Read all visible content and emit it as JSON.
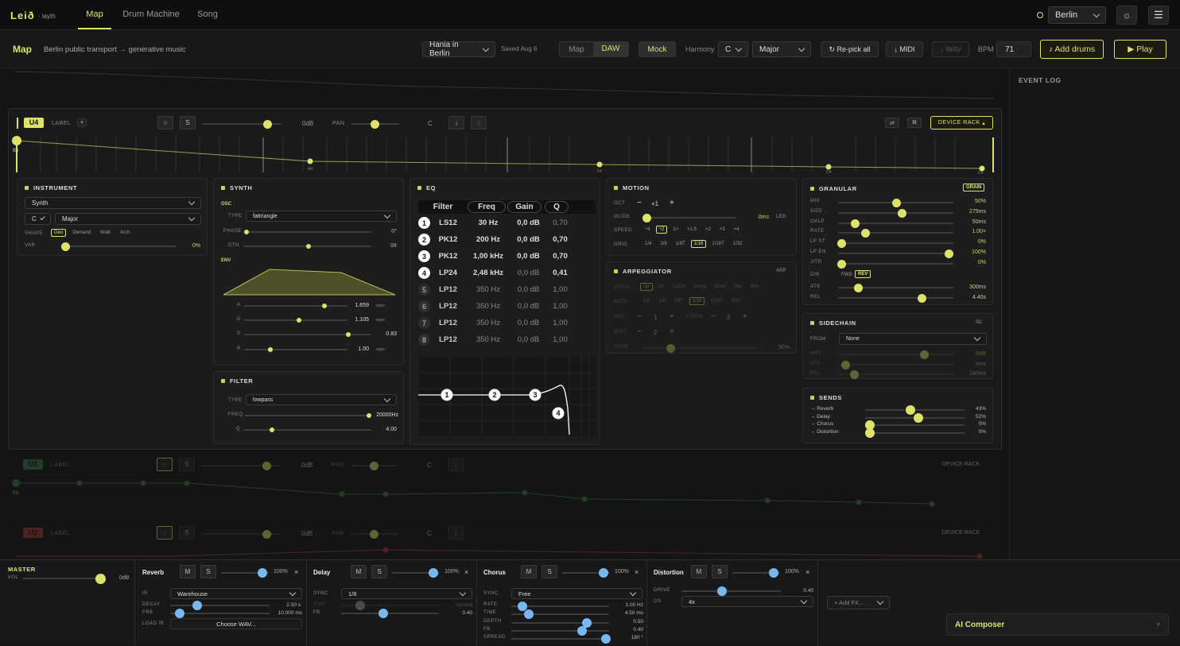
{
  "app": {
    "logo": "Leið",
    "logo_sub": "· layth",
    "tabs": [
      "Map",
      "Drum Machine",
      "Song"
    ],
    "city": "Berlin"
  },
  "subbar": {
    "title": "Map",
    "subtitle": "Berlin public transport → generative music",
    "project": "Hania in Berlin",
    "saved": "Saved Aug 6",
    "view_map": "Map",
    "view_daw": "DAW",
    "mock": "Mock",
    "harmony_label": "Harmony",
    "harmony_key": "C",
    "harmony_scale": "Major",
    "repick": "↻ Re-pick all",
    "midi": "↓ MIDI",
    "wav": "↓ WAV",
    "bpm_label": "BPM",
    "bpm": "71",
    "add_drums": "♪ Add drums",
    "play": "▶ Play"
  },
  "event_log": "EVENT LOG",
  "track": {
    "name": "U4",
    "label": "LABEL",
    "vol": "0dB",
    "pan_label": "PAN",
    "pan": "C",
    "device_rack": "DEVICE RACK",
    "stop_labels": [
      "B6",
      "A4",
      "F4",
      "D4",
      "C4"
    ]
  },
  "instrument": {
    "title": "INSTRUMENT",
    "type": "Synth",
    "key": "C",
    "scale": "Major",
    "shape_label": "SHAPE",
    "shapes": [
      "Geo",
      "Demand",
      "Walk",
      "Arch"
    ],
    "var_label": "VAR",
    "var": "0%"
  },
  "synth": {
    "title": "SYNTH",
    "osc": "OSC",
    "type_label": "TYPE",
    "type": "fattriangle",
    "phase_label": "PHASE",
    "phase": "0°",
    "dtn_label": "DTN",
    "dtn": "0¢",
    "env": "ENV",
    "a": "1.659",
    "d": "1.105",
    "s": "0.83",
    "r": "1.00",
    "curve": "expo"
  },
  "filter": {
    "title": "FILTER",
    "type_label": "TYPE",
    "type": "lowpass",
    "freq_label": "FREQ",
    "freq": "20000Hz",
    "q_label": "Q",
    "q": "4.00"
  },
  "eq": {
    "title": "EQ",
    "headers": [
      "Filter",
      "Freq",
      "Gain",
      "Q"
    ],
    "rows": [
      {
        "n": "1",
        "f": "LS12",
        "freq": "30 Hz",
        "gain": "0,0 dB",
        "q": "0,70",
        "active": true
      },
      {
        "n": "2",
        "f": "PK12",
        "freq": "200 Hz",
        "gain": "0,0 dB",
        "q": "0,70",
        "active": true
      },
      {
        "n": "3",
        "f": "PK12",
        "freq": "1,00 kHz",
        "gain": "0,0 dB",
        "q": "0,70",
        "active": true
      },
      {
        "n": "4",
        "f": "LP24",
        "freq": "2,48 kHz",
        "gain": "0,0 dB",
        "q": "0,41",
        "active": true
      },
      {
        "n": "5",
        "f": "LP12",
        "freq": "350 Hz",
        "gain": "0,0 dB",
        "q": "1,00",
        "active": false
      },
      {
        "n": "6",
        "f": "LP12",
        "freq": "350 Hz",
        "gain": "0,0 dB",
        "q": "1,00",
        "active": false
      },
      {
        "n": "7",
        "f": "LP12",
        "freq": "350 Hz",
        "gain": "0,0 dB",
        "q": "1,00",
        "active": false
      },
      {
        "n": "8",
        "f": "LP12",
        "freq": "350 Hz",
        "gain": "0,0 dB",
        "q": "1,00",
        "active": false
      }
    ]
  },
  "motion": {
    "title": "MOTION",
    "oct_label": "OCT",
    "oct": "+1",
    "glide_label": "GLIDE",
    "glide": "0ms",
    "leg": "LEG",
    "speed_label": "SPEED",
    "speeds": [
      "÷4",
      "÷2",
      "1×",
      "×1.5",
      "×2",
      "×3",
      "×4"
    ],
    "grid_label": "GRID",
    "grids": [
      "1/4",
      "1/8",
      "1/8T",
      "1/16",
      "1/16T",
      "1/32"
    ]
  },
  "arp": {
    "title": "ARPEGGIATOR",
    "tag": "ARP",
    "style_label": "STYLE",
    "styles": [
      "Up",
      "Dn",
      "UpDn",
      "DnUp",
      "Conv",
      "Div",
      "Rnd"
    ],
    "rate_label": "RATE",
    "rates": [
      "1/4",
      "1/8",
      "1/8T",
      "1/16",
      "1/16T",
      "1/32"
    ],
    "oct_label": "OCT",
    "oct": "1",
    "steps_label": "STEPS",
    "steps": "3",
    "dist_label": "DIST",
    "dist": "2",
    "gate_label": "GATE",
    "gate": "50%"
  },
  "granular": {
    "title": "GRANULAR",
    "tag": "GRAIN",
    "params": [
      {
        "k": "MIX",
        "v": "50%",
        "p": 0.5
      },
      {
        "k": "SIZE",
        "v": "275ms",
        "p": 0.55
      },
      {
        "k": "OVLP",
        "v": "50ms",
        "p": 0.12
      },
      {
        "k": "RATE",
        "v": "1.00×",
        "p": 0.22
      },
      {
        "k": "LP ST",
        "v": "0%",
        "p": 0.0
      },
      {
        "k": "LP EN",
        "v": "100%",
        "p": 0.98
      },
      {
        "k": "JITR",
        "v": "0%",
        "p": 0.0
      }
    ],
    "dir_label": "DIR",
    "fwd": "FWD",
    "rev": "REV",
    "atk_label": "ATK",
    "atk": "300ms",
    "rel_label": "REL",
    "rel": "4.40s"
  },
  "sidechain": {
    "title": "SIDECHAIN",
    "tag": "SC",
    "from_label": "FROM",
    "from": "None",
    "amt_label": "AMT",
    "amt": "-9dB",
    "atk_label": "ATK",
    "atk": "5ms",
    "rel_label": "REL",
    "rel": "180ms"
  },
  "sends": {
    "title": "SENDS",
    "items": [
      {
        "k": "→ Reverb",
        "v": "43%",
        "p": 0.43
      },
      {
        "k": "→ Delay",
        "v": "52%",
        "p": 0.52
      },
      {
        "k": "→ Chorus",
        "v": "0%",
        "p": 0
      },
      {
        "k": "→ Distortion",
        "v": "0%",
        "p": 0
      }
    ]
  },
  "ghost_tracks": [
    {
      "name": "U3",
      "color": "#3f7a44",
      "label": "LABEL",
      "vol": "0dB",
      "pan": "PAN",
      "pan_v": "C",
      "rack": "DEVICE RACK",
      "stop": "E6"
    },
    {
      "name": "U2",
      "color": "#b03a3a",
      "label": "LABEL",
      "vol": "0dB",
      "pan": "PAN",
      "pan_v": "C",
      "rack": "DEVICE RACK"
    }
  ],
  "master": {
    "title": "MASTER",
    "vol_label": "VOL",
    "vol": "0dB"
  },
  "reverb": {
    "title": "Reverb",
    "mix": "100%",
    "ir_label": "IR",
    "ir": "Warehouse",
    "decay_label": "DECAY",
    "decay": "2.50 s",
    "pre_label": "PRE",
    "pre": "10.000 ms",
    "load_label": "LOAD IR",
    "choose": "Choose WAV..."
  },
  "delay": {
    "title": "Delay",
    "mix": "100%",
    "sync_label": "SYNC",
    "sync": "1/8",
    "time_label": "TIME",
    "time": "synced",
    "fb_label": "FB",
    "fb": "0.40"
  },
  "chorus": {
    "title": "Chorus",
    "mix": "100%",
    "sync_label": "SYNC",
    "sync": "Free",
    "rate_label": "RATE",
    "rate": "1.00 Hz",
    "time_label": "TIME",
    "time": "4.50 ms",
    "depth_label": "DEPTH",
    "depth": "0.50",
    "fb_label": "FB",
    "fb": "0.40",
    "spread_label": "SPREAD",
    "spread": "180 °"
  },
  "distortion": {
    "title": "Distortion",
    "mix": "100%",
    "drive_label": "DRIVE",
    "drive": "0.40",
    "os_label": "OS",
    "os": "4x"
  },
  "add_fx": "+ Add FX...",
  "ai": "AI Composer",
  "colors": {
    "accent": "#dde26a",
    "blue": "#78b8f0",
    "bg": "#141414"
  }
}
